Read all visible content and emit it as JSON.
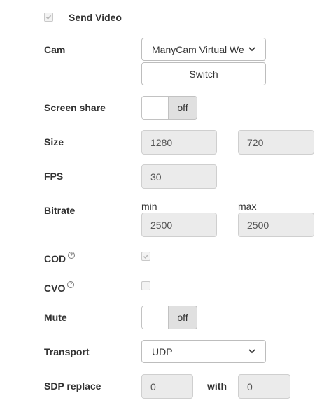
{
  "send_video": {
    "label": "Send Video",
    "checked": true
  },
  "cam": {
    "label": "Cam",
    "selected": "ManyCam Virtual Webcam",
    "switch_label": "Switch"
  },
  "screen_share": {
    "label": "Screen share",
    "state": "off"
  },
  "size": {
    "label": "Size",
    "width": "1280",
    "height": "720"
  },
  "fps": {
    "label": "FPS",
    "value": "30"
  },
  "bitrate": {
    "label": "Bitrate",
    "min_label": "min",
    "min_value": "2500",
    "max_label": "max",
    "max_value": "2500"
  },
  "cod": {
    "label": "COD",
    "help": "?",
    "checked": true
  },
  "cvo": {
    "label": "CVO",
    "help": "?",
    "checked": false
  },
  "mute": {
    "label": "Mute",
    "state": "off"
  },
  "transport": {
    "label": "Transport",
    "selected": "UDP"
  },
  "sdp_replace": {
    "label": "SDP replace",
    "value": "0",
    "with_label": "with",
    "with_value": "0"
  }
}
